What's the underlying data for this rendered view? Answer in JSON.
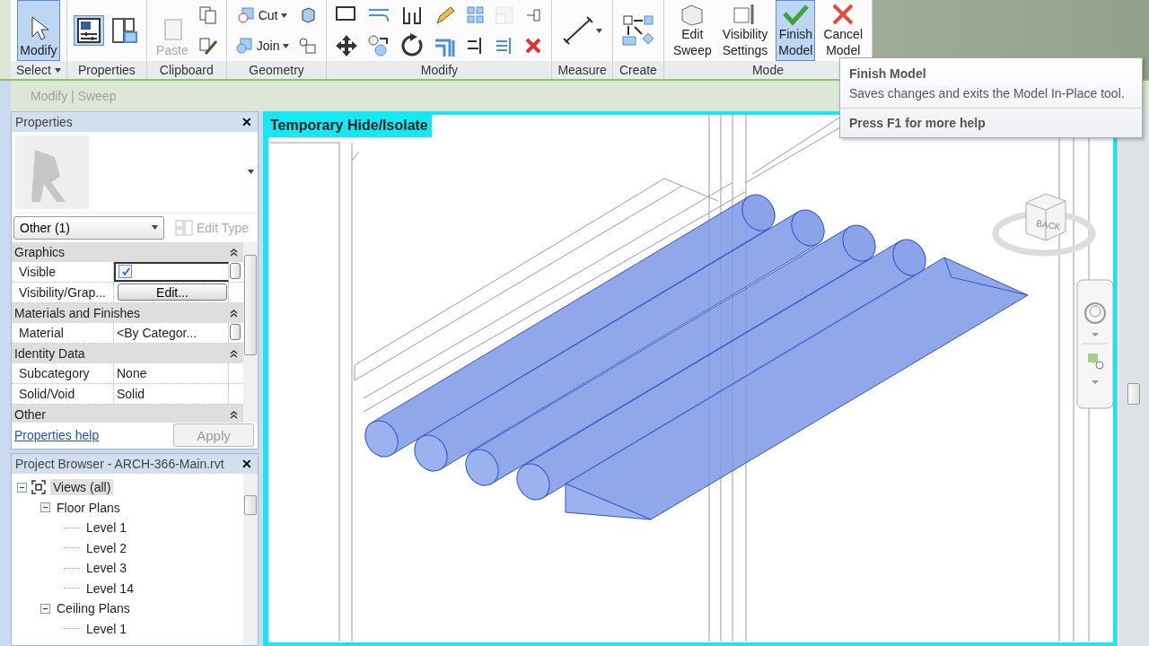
{
  "ribbon": {
    "panels": [
      {
        "label": "Select",
        "dropdown": true,
        "tools": [
          {
            "kind": "large",
            "label": "Modify",
            "selected": true,
            "disabled": false
          }
        ]
      },
      {
        "label": "Properties",
        "tools": [
          {
            "kind": "tile",
            "selected": true,
            "disabled": false
          },
          {
            "kind": "tile",
            "selected": false,
            "disabled": false
          }
        ]
      },
      {
        "label": "Clipboard",
        "tools": [
          {
            "kind": "large",
            "label": "Paste",
            "selected": false,
            "disabled": true
          },
          {
            "kind": "icon",
            "selected": false,
            "disabled": false
          },
          {
            "kind": "icon",
            "selected": false,
            "disabled": false
          }
        ]
      },
      {
        "label": "Geometry",
        "tools": [
          {
            "kind": "small",
            "label": "Cut",
            "selected": false,
            "disabled": false
          },
          {
            "kind": "small",
            "label": "Join",
            "selected": false,
            "disabled": false
          },
          {
            "kind": "icon",
            "selected": false,
            "disabled": false
          },
          {
            "kind": "icon",
            "selected": false,
            "disabled": false
          }
        ]
      },
      {
        "label": "Modify",
        "tools": [
          {
            "kind": "icon",
            "selected": false,
            "disabled": false
          },
          {
            "kind": "icon",
            "selected": false,
            "disabled": false
          },
          {
            "kind": "icon",
            "selected": false,
            "disabled": false
          },
          {
            "kind": "icon",
            "selected": false,
            "disabled": false
          },
          {
            "kind": "icon",
            "selected": false,
            "disabled": false
          },
          {
            "kind": "icon",
            "selected": false,
            "disabled": false
          },
          {
            "kind": "icon",
            "selected": false,
            "disabled": false
          },
          {
            "kind": "icon",
            "selected": false,
            "disabled": false
          },
          {
            "kind": "icon",
            "selected": false,
            "disabled": false
          },
          {
            "kind": "icon",
            "selected": false,
            "disabled": false
          },
          {
            "kind": "icon",
            "selected": false,
            "disabled": true
          },
          {
            "kind": "icon",
            "selected": false,
            "disabled": false
          },
          {
            "kind": "icon",
            "selected": false,
            "disabled": false
          },
          {
            "kind": "icon",
            "selected": false,
            "disabled": false
          }
        ]
      },
      {
        "label": "Measure",
        "tools": [
          {
            "kind": "tile",
            "selected": false,
            "disabled": false
          }
        ]
      },
      {
        "label": "Create",
        "tools": [
          {
            "kind": "tile",
            "selected": false,
            "disabled": false
          }
        ]
      },
      {
        "label": "Mode",
        "tools": [
          {
            "kind": "large",
            "label": "Edit Sweep",
            "selected": false,
            "disabled": false
          },
          {
            "kind": "large",
            "label": "Visibility Settings",
            "selected": false,
            "disabled": false
          },
          {
            "kind": "large",
            "label": "Finish Model",
            "selected": true,
            "disabled": false
          },
          {
            "kind": "large",
            "label": "Cancel Model",
            "selected": false,
            "disabled": false
          }
        ]
      }
    ]
  },
  "context_bar": {
    "text": "Modify | Sweep"
  },
  "properties": {
    "title": "Properties",
    "close": "✕",
    "type_selector": "Other (1)",
    "edit_type": "Edit Type",
    "groups": [
      {
        "name": "Graphics",
        "expanded": true,
        "rows": [
          {
            "label": "Visible",
            "kind": "checkbox",
            "checked": true
          },
          {
            "label": "Visibility/Grap...",
            "kind": "button",
            "value": "Edit..."
          }
        ]
      },
      {
        "name": "Materials and Finishes",
        "expanded": true,
        "rows": [
          {
            "label": "Material",
            "kind": "browse",
            "value": "<By Categor..."
          }
        ]
      },
      {
        "name": "Identity Data",
        "expanded": true,
        "rows": [
          {
            "label": "Subcategory",
            "kind": "text",
            "value": "None"
          },
          {
            "label": "Solid/Void",
            "kind": "text",
            "value": "Solid"
          }
        ]
      },
      {
        "name": "Other",
        "expanded": true
      }
    ],
    "help_link": "Properties help",
    "apply": "Apply"
  },
  "project_browser": {
    "title": "Project Browser - ARCH-366-Main.rvt",
    "close": "✕",
    "tree": [
      {
        "label": "Views (all)",
        "expanded": true,
        "selected": true,
        "children": [
          {
            "label": "Floor Plans",
            "expanded": true,
            "selected": false,
            "children": [
              {
                "label": "Level 1",
                "selected": false
              },
              {
                "label": "Level 2",
                "selected": false
              },
              {
                "label": "Level 3",
                "selected": false
              },
              {
                "label": "Level 14",
                "selected": false
              }
            ]
          },
          {
            "label": "Ceiling Plans",
            "expanded": true,
            "selected": false,
            "children": [
              {
                "label": "Level 1",
                "selected": false
              }
            ]
          }
        ]
      }
    ]
  },
  "viewport": {
    "mode_label": "Temporary Hide/Isolate",
    "view_cube": {
      "face": "BACK"
    }
  },
  "tooltip": {
    "title": "Finish Model",
    "description": "Saves changes and exits the Model In-Place tool.",
    "help": "Press F1 for more help"
  }
}
